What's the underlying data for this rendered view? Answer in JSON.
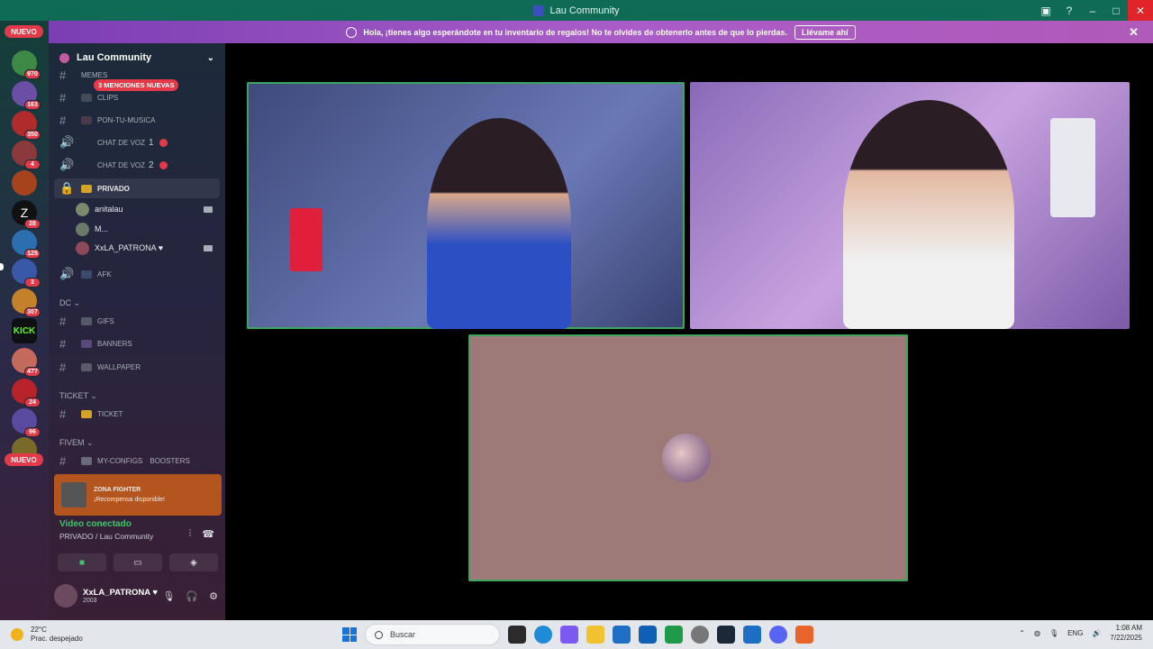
{
  "window": {
    "title": "Lau Community"
  },
  "notice": {
    "text": "Hola, ¡tienes algo esperándote en tu inventario de regalos! No te olvides de obtenerlo antes de que lo pierdas.",
    "cta": "Llévame ahí"
  },
  "rail": {
    "nuevo_top": "NUEVO",
    "nuevo_bottom": "NUEVO",
    "badges": [
      "970",
      "163",
      "350",
      "4",
      "",
      "28",
      "125",
      "3",
      "307",
      "",
      "477",
      "24",
      "96",
      ""
    ],
    "kick_label": "KICK"
  },
  "sidebar": {
    "server_name": "Lau Community",
    "mentions": "3 MENCIONES NUEVAS",
    "channels": {
      "memes": "MEMES",
      "clips": "CLIPS",
      "pon_tu_musica": "PON-TU-MUSICA",
      "chat_voz_1": "CHAT DE VOZ",
      "chat_voz_1_num": "1",
      "chat_voz_2": "CHAT DE VOZ",
      "chat_voz_2_num": "2",
      "privado": "PRIVADO",
      "afk": "AFK",
      "gifs": "GIFS",
      "banners": "BANNERS",
      "wallpaper": "WALLPAPER",
      "ticket": "TICKET",
      "my_configs": "MY-CONFIGS",
      "boosters": "BOOSTERS"
    },
    "members": [
      "anitalau",
      "M...",
      "XxLA_PATRONA ♥"
    ],
    "categories": {
      "dc": "DC",
      "ticket": "TICKET",
      "fivem": "FIVEM"
    },
    "reward": {
      "header": "ZONA FIGHTER",
      "text": "¡Recompensa disponible!"
    },
    "voice": {
      "status": "Video conectado",
      "location": "PRIVADO / Lau Community"
    },
    "user": {
      "name": "XxLA_PATRONA ♥",
      "status": "2003"
    }
  },
  "taskbar": {
    "temp": "22°C",
    "weather": "Prac. despejado",
    "search_placeholder": "Buscar",
    "lang": "ENG",
    "time": "1:08 AM",
    "date": "7/22/2025"
  },
  "colors": {
    "titlebar": "#0f6a56",
    "banner": "#a95cc8",
    "speaking": "#3ba55d",
    "badge": "#e33a4a"
  }
}
